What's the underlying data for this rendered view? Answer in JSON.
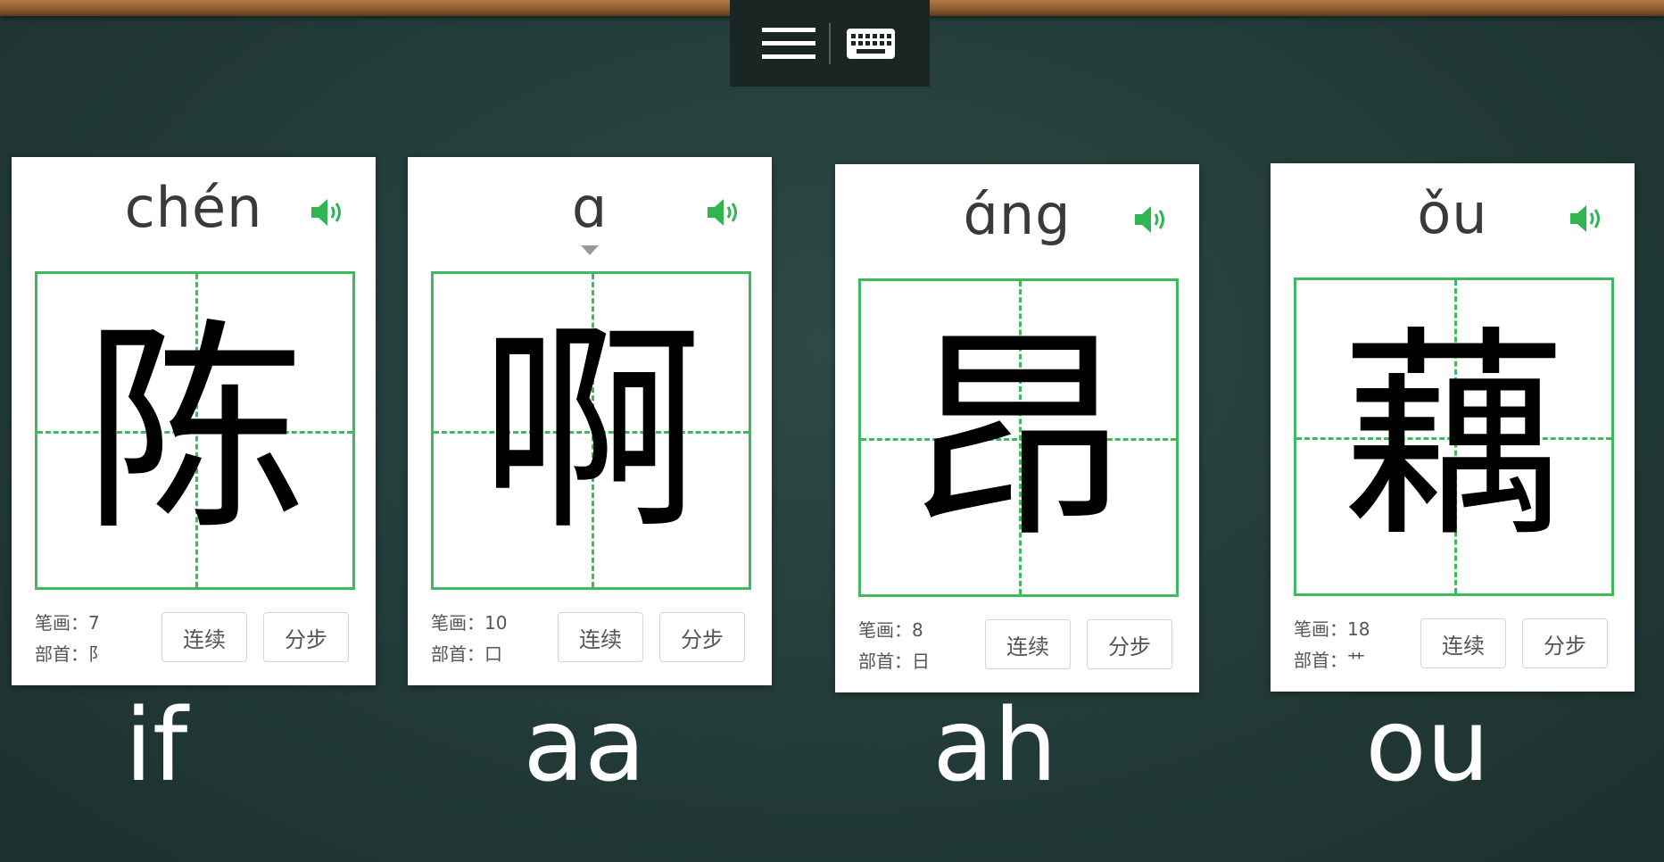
{
  "toolbar": {
    "menu_icon": "hamburger-menu-icon",
    "keyboard_icon": "keyboard-icon"
  },
  "colors": {
    "board": "#243d3a",
    "grid_green": "#3cba5e",
    "speaker_green": "#2fb552",
    "frame_wood": "#8a5a2f"
  },
  "labels": {
    "strokes": "笔画：",
    "radical": "部首："
  },
  "cards": [
    {
      "pinyin": "chén",
      "character": "陈",
      "strokes": "7",
      "radical": "阝",
      "btn_continuous": "连续",
      "btn_step": "分步",
      "caption": "if",
      "marker": false
    },
    {
      "pinyin": "ɑ",
      "character": "啊",
      "strokes": "10",
      "radical": "口",
      "btn_continuous": "连续",
      "btn_step": "分步",
      "caption": "aa",
      "marker": true
    },
    {
      "pinyin": "ɑ́ng",
      "character": "昂",
      "strokes": "8",
      "radical": "日",
      "btn_continuous": "连续",
      "btn_step": "分步",
      "caption": "ah",
      "marker": false
    },
    {
      "pinyin": "ǒu",
      "character": "藕",
      "strokes": "18",
      "radical": "艹",
      "btn_continuous": "连续",
      "btn_step": "分步",
      "caption": "ou",
      "marker": false
    }
  ]
}
